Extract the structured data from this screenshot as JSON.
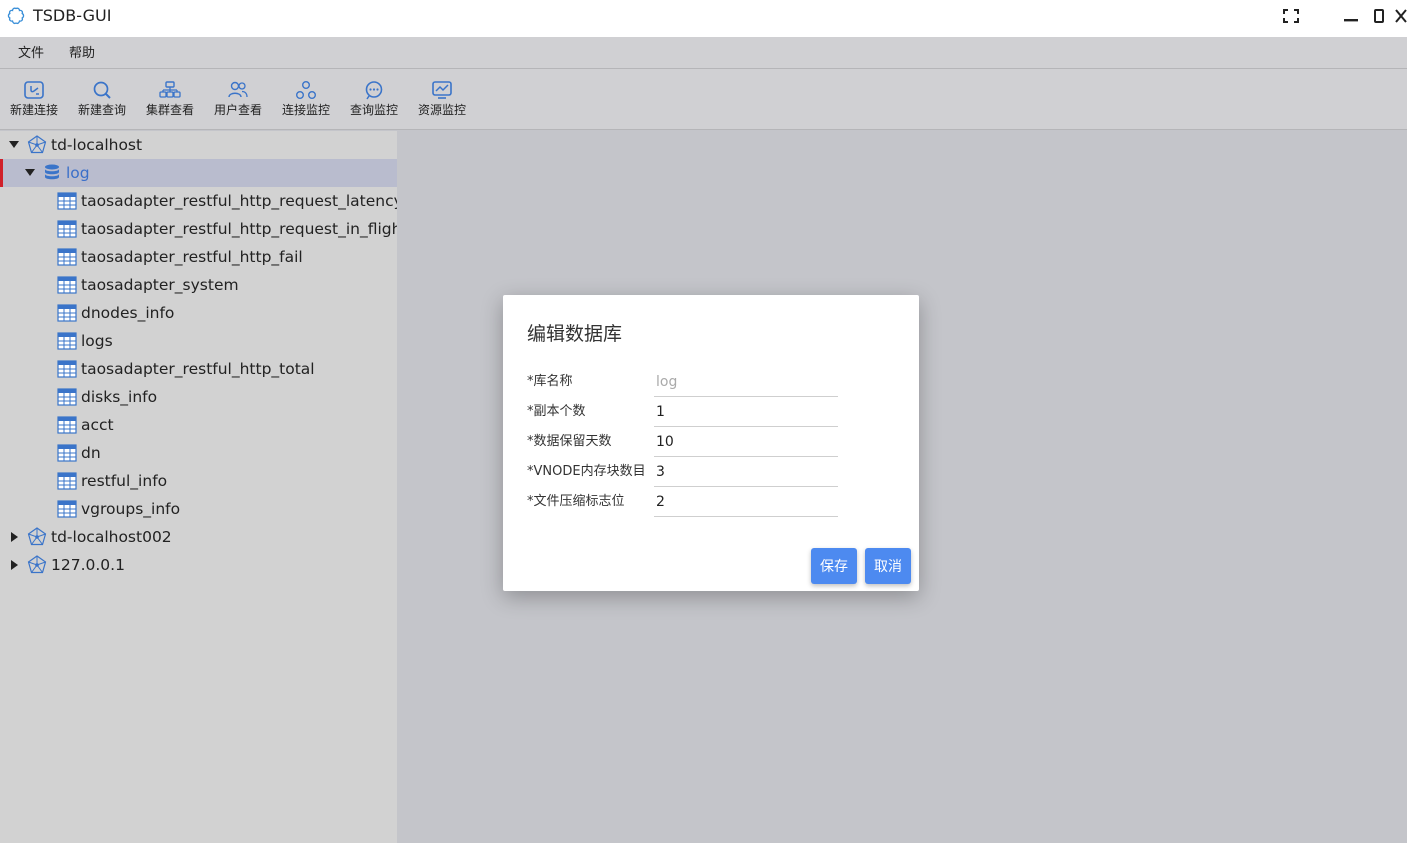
{
  "window": {
    "title": "TSDB-GUI",
    "icon": "cloud-flower-icon",
    "controls": [
      "fullscreen-icon",
      "minimize-icon",
      "maximize-icon",
      "close-icon"
    ]
  },
  "menu": {
    "items": [
      {
        "label": "文件"
      },
      {
        "label": "帮助"
      }
    ]
  },
  "toolbar": {
    "buttons": [
      {
        "label": "新建连接",
        "icon": "new-connection-icon"
      },
      {
        "label": "新建查询",
        "icon": "new-query-icon"
      },
      {
        "label": "集群查看",
        "icon": "cluster-view-icon"
      },
      {
        "label": "用户查看",
        "icon": "users-view-icon"
      },
      {
        "label": "连接监控",
        "icon": "connection-monitor-icon"
      },
      {
        "label": "查询监控",
        "icon": "query-monitor-icon"
      },
      {
        "label": "资源监控",
        "icon": "resource-monitor-icon"
      }
    ]
  },
  "tree": {
    "connections": [
      {
        "label": "td-localhost",
        "expanded": true,
        "databases": [
          {
            "label": "log",
            "expanded": true,
            "selected": true,
            "tables": [
              "taosadapter_restful_http_request_latency",
              "taosadapter_restful_http_request_in_flight",
              "taosadapter_restful_http_fail",
              "taosadapter_system",
              "dnodes_info",
              "logs",
              "taosadapter_restful_http_total",
              "disks_info",
              "acct",
              "dn",
              "restful_info",
              "vgroups_info"
            ]
          }
        ]
      },
      {
        "label": "td-localhost002",
        "expanded": false
      },
      {
        "label": "127.0.0.1",
        "expanded": false
      }
    ]
  },
  "dialog": {
    "title": "编辑数据库",
    "fields": [
      {
        "label": "*库名称",
        "value": "log",
        "disabled": true
      },
      {
        "label": "*副本个数",
        "value": "1"
      },
      {
        "label": "*数据保留天数",
        "value": "10"
      },
      {
        "label": "*VNODE内存块数目",
        "value": "3"
      },
      {
        "label": "*文件压缩标志位",
        "value": "2"
      }
    ],
    "save_label": "保存",
    "cancel_label": "取消"
  },
  "colors": {
    "accent": "#4d8af0",
    "selection_marker": "#d0202a",
    "selected_row": "#b9bcce",
    "icon_blue": "#3a74c9"
  }
}
